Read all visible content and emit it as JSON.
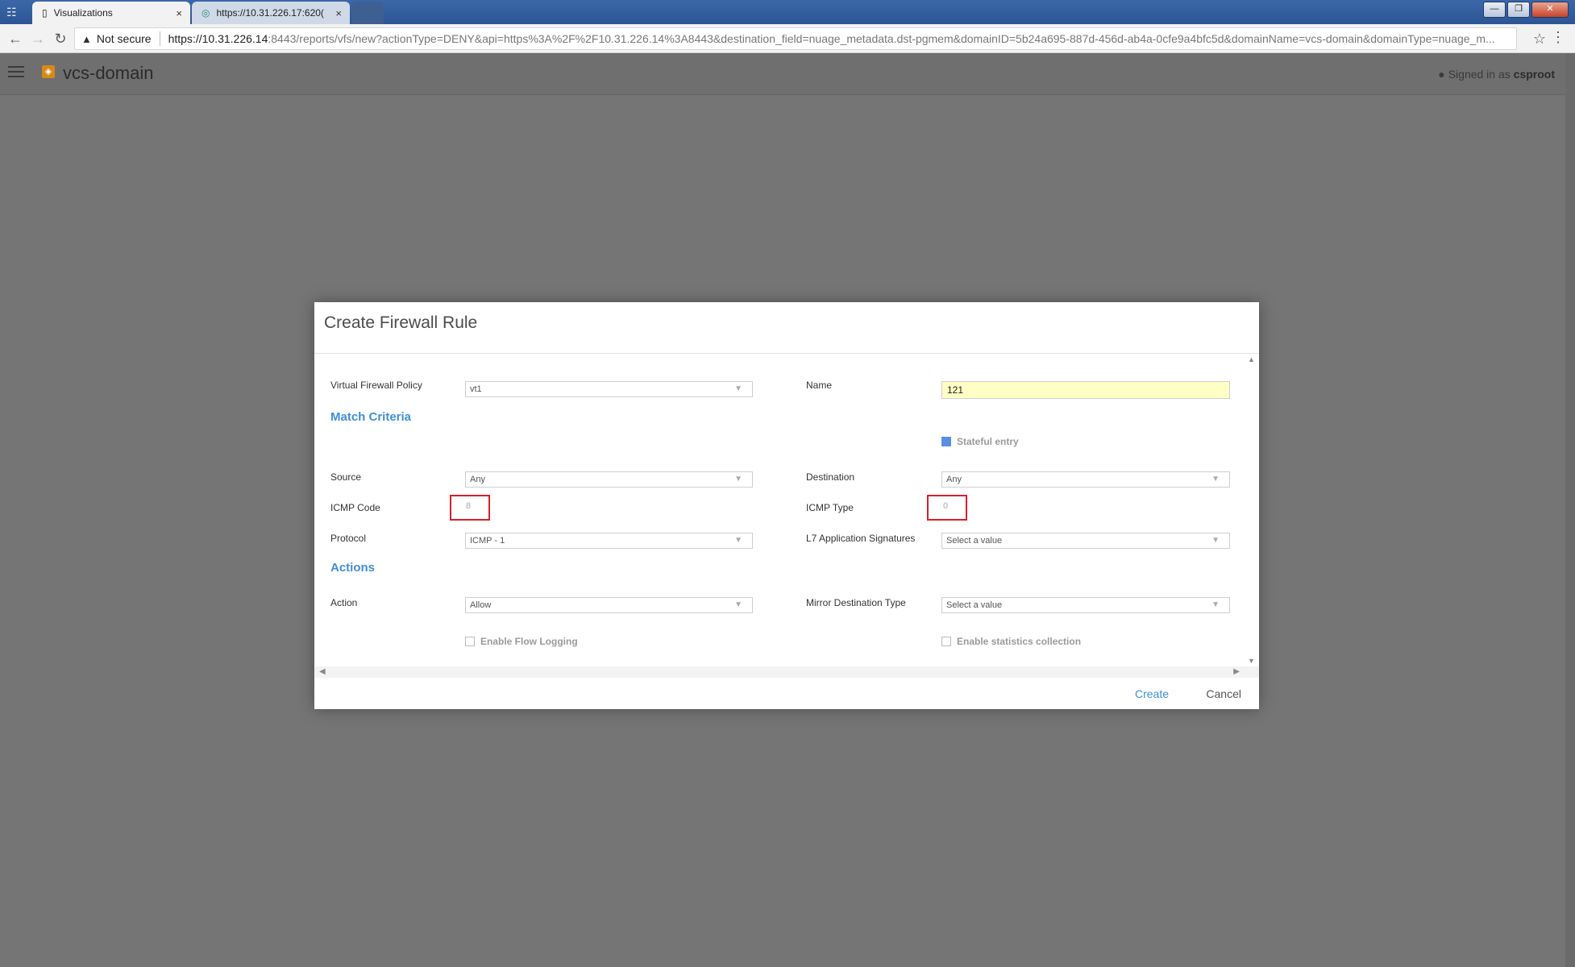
{
  "browser": {
    "tabs": [
      {
        "title": "Visualizations",
        "close": "×"
      },
      {
        "title": "https://10.31.226.17:620(",
        "close": "×"
      }
    ],
    "security": "Not secure",
    "url": {
      "scheme": "https",
      "host": "://10.31.226.14",
      "rest": ":8443/reports/vfs/new?actionType=DENY&api=https%3A%2F%2F10.31.226.14%3A8443&destination_field=nuage_metadata.dst-pgmem&domainID=5b24a695-887d-456d-ab4a-0cfe9a4bfc5d&domainName=vcs-domain&domainType=nuage_m..."
    }
  },
  "header": {
    "domain": "vcs-domain",
    "signed_in_prefix": "Signed in as",
    "username": "csproot"
  },
  "modal": {
    "title": "Create Firewall Rule",
    "labels": {
      "policy": "Virtual Firewall Policy",
      "name": "Name",
      "source": "Source",
      "destination": "Destination",
      "icmp_code": "ICMP Code",
      "icmp_type": "ICMP Type",
      "protocol": "Protocol",
      "l7": "L7 Application Signatures",
      "action": "Action",
      "mirror": "Mirror Destination Type"
    },
    "sections": {
      "match": "Match Criteria",
      "actions": "Actions"
    },
    "values": {
      "policy": "vt1",
      "name": "121",
      "source": "Any",
      "destination": "Any",
      "icmp_code": "8",
      "icmp_type": "0",
      "protocol": "ICMP - 1",
      "l7": "Select a value",
      "action": "Allow",
      "mirror": "Select a value"
    },
    "checkboxes": {
      "stateful": "Stateful entry",
      "flow_logging": "Enable Flow Logging",
      "stats": "Enable statistics collection"
    },
    "buttons": {
      "create": "Create",
      "cancel": "Cancel"
    }
  }
}
